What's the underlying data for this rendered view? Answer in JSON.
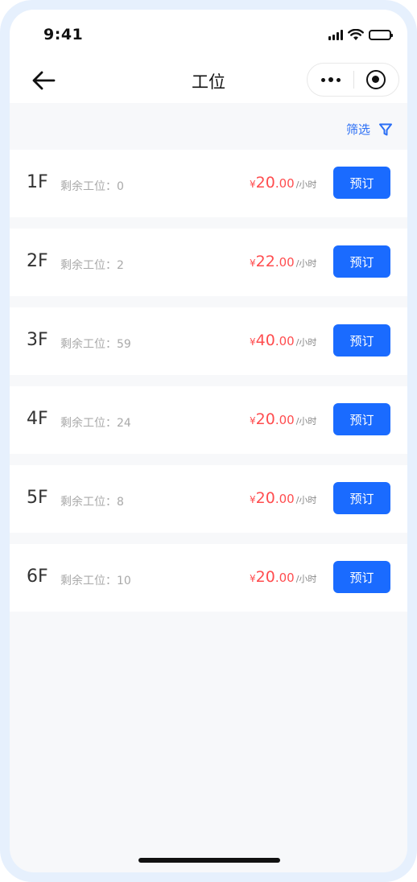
{
  "status": {
    "time": "9:41"
  },
  "nav": {
    "title": "工位"
  },
  "filter": {
    "label": "筛选"
  },
  "price_unit": "/小时",
  "currency": "¥",
  "book_label": "预订",
  "remain_prefix": "剩余工位：",
  "items": [
    {
      "floor": "1F",
      "remaining": "0",
      "price_int": "20",
      "price_dec": ".00"
    },
    {
      "floor": "2F",
      "remaining": "2",
      "price_int": "22",
      "price_dec": ".00"
    },
    {
      "floor": "3F",
      "remaining": "59",
      "price_int": "40",
      "price_dec": ".00"
    },
    {
      "floor": "4F",
      "remaining": "24",
      "price_int": "20",
      "price_dec": ".00"
    },
    {
      "floor": "5F",
      "remaining": "8",
      "price_int": "20",
      "price_dec": ".00"
    },
    {
      "floor": "6F",
      "remaining": "10",
      "price_int": "20",
      "price_dec": ".00"
    }
  ],
  "colors": {
    "accent": "#1a6bff",
    "price": "#ff4d4f",
    "filter": "#2a6ef5"
  }
}
